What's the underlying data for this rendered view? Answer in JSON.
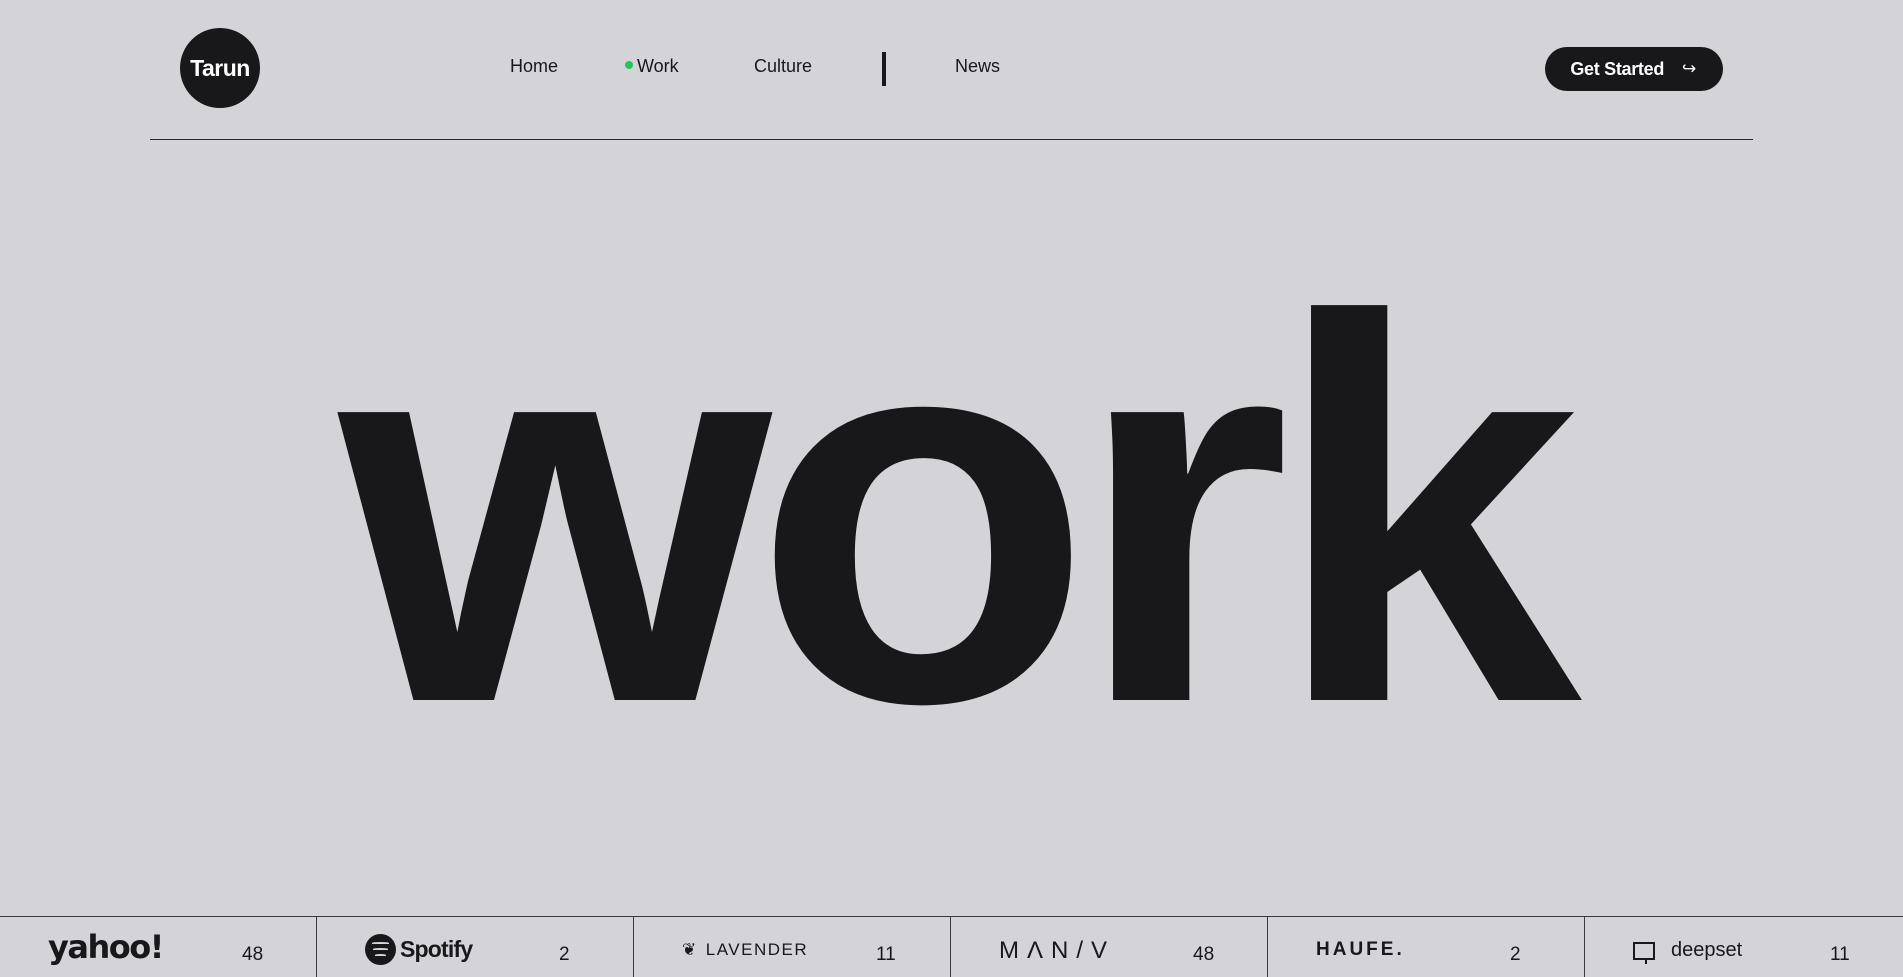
{
  "header": {
    "logo_text": "Tarun",
    "nav": [
      {
        "label": "Home"
      },
      {
        "label": "Work",
        "active": true
      },
      {
        "label": "Culture"
      },
      {
        "label": "News"
      }
    ],
    "cta_label": "Get Started",
    "cta_icon": "↪"
  },
  "hero": {
    "title": "work"
  },
  "clients": [
    {
      "name": "yahoo!",
      "count": "48",
      "icon": "yahoo-logo"
    },
    {
      "name": "Spotify",
      "count": "2",
      "icon": "spotify-logo"
    },
    {
      "name": "LAVENDER",
      "count": "11",
      "icon": "lavender-logo"
    },
    {
      "name": "MΛN/V",
      "count": "48",
      "icon": "maniv-logo"
    },
    {
      "name": "HAUFE.",
      "count": "2",
      "icon": "haufe-logo"
    },
    {
      "name": "deepset",
      "count": "11",
      "icon": "deepset-logo"
    }
  ],
  "colors": {
    "background": "#d4d3d8",
    "foreground": "#18181b",
    "active_dot": "#22c55e"
  }
}
